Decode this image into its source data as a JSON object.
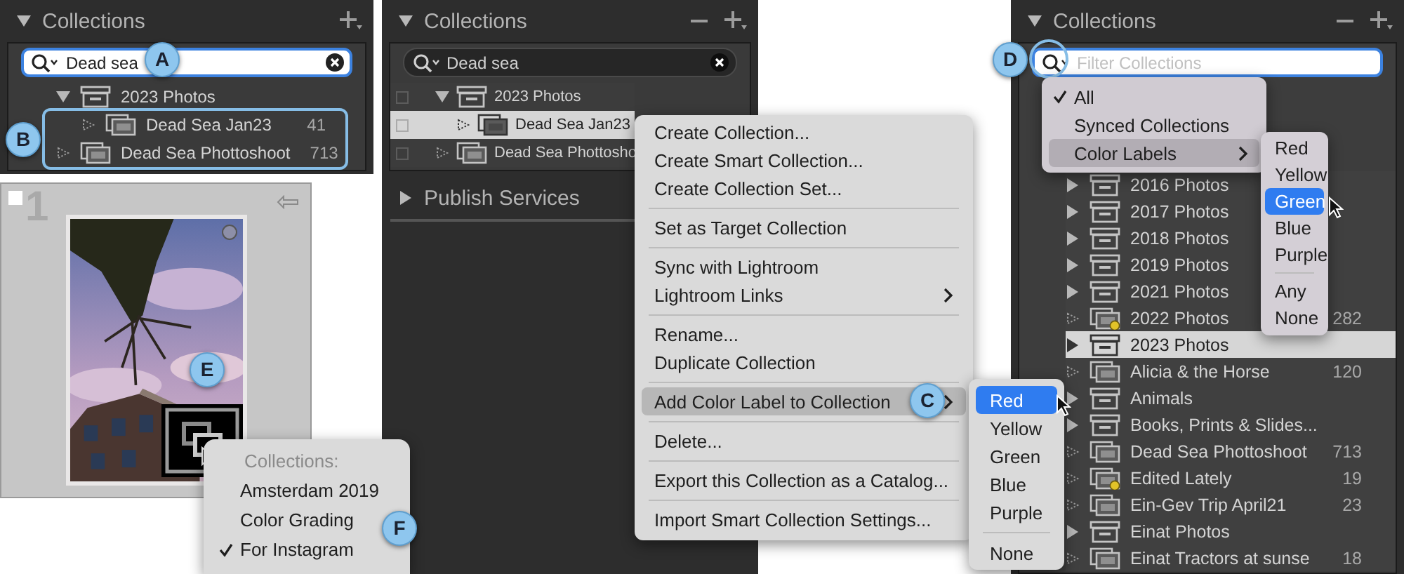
{
  "left_panel": {
    "title": "Collections",
    "expanded": true,
    "remove_button": false,
    "search": {
      "value": "Dead sea",
      "focused": true,
      "callout": "A"
    },
    "highlight": {
      "callout": "B"
    },
    "items": [
      {
        "kind": "set",
        "name": "2023 Photos",
        "expanded": true,
        "selected": false,
        "children": [
          {
            "kind": "collection",
            "name": "Dead Sea Jan23",
            "count": "41",
            "selected": false
          }
        ]
      },
      {
        "kind": "collection",
        "name": "Dead Sea Phottoshoot",
        "count": "713",
        "selected": false
      }
    ]
  },
  "thumbnail": {
    "index": "1",
    "callout": "E",
    "popup": {
      "callout": "F",
      "items": [
        {
          "kind": "header",
          "label": "Collections:"
        },
        {
          "kind": "item",
          "label": "Amsterdam 2019",
          "checked": false
        },
        {
          "kind": "item",
          "label": "Color Grading",
          "checked": false
        },
        {
          "kind": "item",
          "label": "For Instagram",
          "checked": true
        }
      ]
    }
  },
  "middle_panel": {
    "title": "Collections",
    "expanded": true,
    "remove_button": true,
    "search": {
      "value": "Dead sea",
      "focused": false
    },
    "items": [
      {
        "kind": "set",
        "name": "2023 Photos",
        "expanded": true,
        "selected": false,
        "children": [
          {
            "kind": "collection",
            "name": "Dead Sea Jan23",
            "selected": true
          }
        ]
      },
      {
        "kind": "collection",
        "name": "Dead Sea Phottosho",
        "selected": false
      }
    ],
    "publish_services": {
      "title": "Publish Services",
      "expanded": false
    },
    "context_menu": {
      "items": [
        {
          "kind": "item",
          "label": "Create Collection...",
          "submenu": false,
          "open": false
        },
        {
          "kind": "item",
          "label": "Create Smart Collection...",
          "submenu": false,
          "open": false
        },
        {
          "kind": "item",
          "label": "Create Collection Set...",
          "submenu": false,
          "open": false
        },
        {
          "kind": "separator"
        },
        {
          "kind": "item",
          "label": "Set as Target Collection",
          "submenu": false,
          "open": false
        },
        {
          "kind": "separator"
        },
        {
          "kind": "item",
          "label": "Sync with Lightroom",
          "submenu": false,
          "open": false
        },
        {
          "kind": "item",
          "label": "Lightroom Links",
          "submenu": true,
          "open": false
        },
        {
          "kind": "separator"
        },
        {
          "kind": "item",
          "label": "Rename...",
          "submenu": false,
          "open": false
        },
        {
          "kind": "item",
          "label": "Duplicate Collection",
          "submenu": false,
          "open": false
        },
        {
          "kind": "separator"
        },
        {
          "kind": "item",
          "label": "Add Color Label to Collection",
          "submenu": true,
          "open": true,
          "callout": "C"
        },
        {
          "kind": "separator"
        },
        {
          "kind": "item",
          "label": "Delete...",
          "submenu": false,
          "open": false
        },
        {
          "kind": "separator"
        },
        {
          "kind": "item",
          "label": "Export this Collection as a Catalog...",
          "submenu": false,
          "open": false
        },
        {
          "kind": "separator"
        },
        {
          "kind": "item",
          "label": "Import Smart Collection Settings...",
          "submenu": false,
          "open": false
        }
      ]
    },
    "color_submenu": {
      "items": [
        {
          "kind": "item",
          "label": "Red",
          "selected": true
        },
        {
          "kind": "item",
          "label": "Yellow",
          "selected": false
        },
        {
          "kind": "item",
          "label": "Green",
          "selected": false
        },
        {
          "kind": "item",
          "label": "Blue",
          "selected": false
        },
        {
          "kind": "item",
          "label": "Purple",
          "selected": false
        },
        {
          "kind": "separator"
        },
        {
          "kind": "item",
          "label": "None",
          "selected": false
        }
      ]
    }
  },
  "right_panel": {
    "title": "Collections",
    "expanded": true,
    "remove_button": true,
    "search": {
      "placeholder": "Filter Collections",
      "focused": true,
      "callout": "D"
    },
    "filter_menu": {
      "items": [
        {
          "kind": "item",
          "label": "All",
          "checked": true,
          "submenu": false,
          "open": false
        },
        {
          "kind": "item",
          "label": "Synced Collections",
          "checked": false,
          "submenu": false,
          "open": false
        },
        {
          "kind": "item",
          "label": "Color Labels",
          "checked": false,
          "submenu": true,
          "open": true
        }
      ]
    },
    "color_menu": {
      "items": [
        {
          "kind": "item",
          "label": "Red",
          "selected": false
        },
        {
          "kind": "item",
          "label": "Yellow",
          "selected": false
        },
        {
          "kind": "item",
          "label": "Green",
          "selected": true
        },
        {
          "kind": "item",
          "label": "Blue",
          "selected": false
        },
        {
          "kind": "item",
          "label": "Purple",
          "selected": false
        },
        {
          "kind": "separator"
        },
        {
          "kind": "item",
          "label": "Any",
          "selected": false
        },
        {
          "kind": "item",
          "label": "None",
          "selected": false
        }
      ]
    },
    "items": [
      {
        "kind": "set",
        "name": "2016 Photos",
        "expanded": false,
        "selected": false
      },
      {
        "kind": "set",
        "name": "2017 Photos",
        "expanded": false,
        "selected": false
      },
      {
        "kind": "set",
        "name": "2018 Photos",
        "expanded": false,
        "selected": false
      },
      {
        "kind": "set",
        "name": "2019 Photos",
        "expanded": false,
        "selected": false
      },
      {
        "kind": "set",
        "name": "2021 Photos",
        "expanded": false,
        "selected": false
      },
      {
        "kind": "smart",
        "name": "2022 Photos",
        "count": "282",
        "selected": false
      },
      {
        "kind": "set",
        "name": "2023 Photos",
        "expanded": false,
        "selected": true
      },
      {
        "kind": "collection",
        "name": "Alicia & the Horse",
        "count": "120",
        "selected": false
      },
      {
        "kind": "set",
        "name": "Animals",
        "expanded": false,
        "selected": false
      },
      {
        "kind": "set",
        "name": "Books, Prints & Slides...",
        "expanded": false,
        "selected": false
      },
      {
        "kind": "collection",
        "name": "Dead Sea Phottoshoot",
        "count": "713",
        "selected": false
      },
      {
        "kind": "smart",
        "name": "Edited Lately",
        "count": "19",
        "selected": false
      },
      {
        "kind": "collection",
        "name": "Ein-Gev Trip April21",
        "count": "23",
        "selected": false
      },
      {
        "kind": "set",
        "name": "Einat Photos",
        "expanded": false,
        "selected": false
      },
      {
        "kind": "collection",
        "name": "Einat Tractors at sunse",
        "count": "18",
        "selected": false
      }
    ]
  }
}
